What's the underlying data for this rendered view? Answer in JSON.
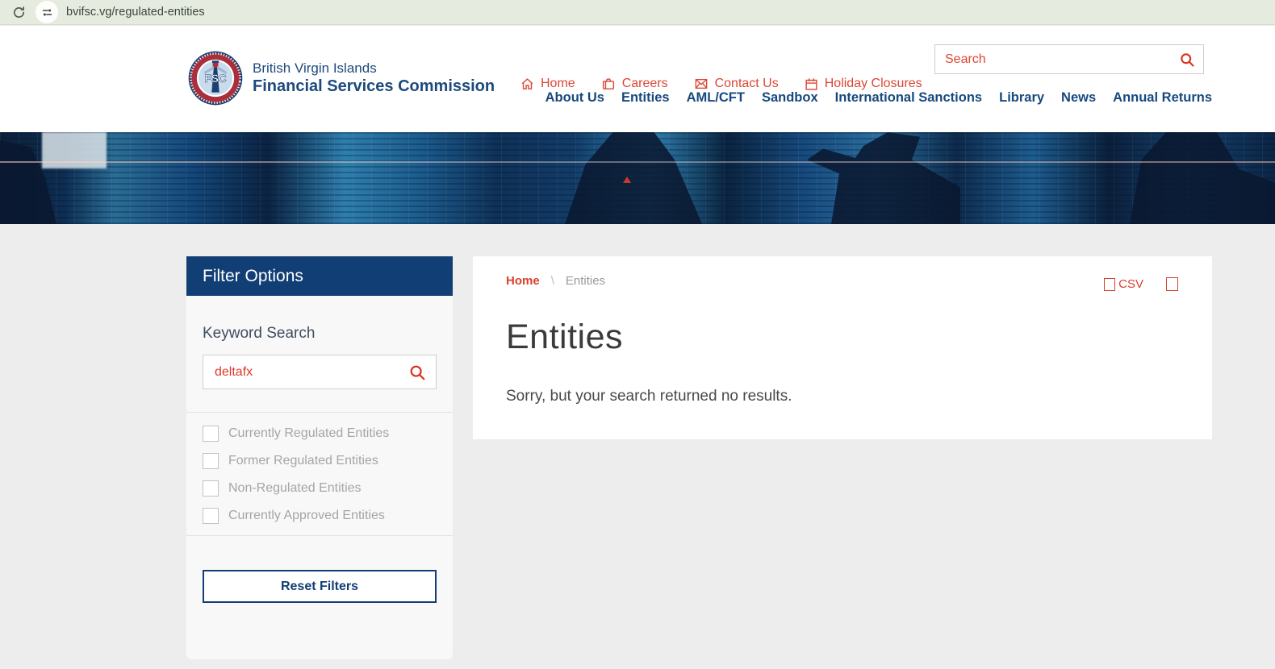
{
  "browser": {
    "url": "bvifsc.vg/regulated-entities"
  },
  "header": {
    "logo": {
      "line1": "British Virgin Islands",
      "line2": "Financial Services Commission",
      "seal_center_text": "FSC"
    },
    "utility_nav": [
      {
        "label": "Home",
        "icon": "home-icon"
      },
      {
        "label": "Careers",
        "icon": "briefcase-icon"
      },
      {
        "label": "Contact Us",
        "icon": "envelope-icon"
      },
      {
        "label": "Holiday Closures",
        "icon": "calendar-icon"
      }
    ],
    "search": {
      "placeholder": "Search"
    },
    "main_nav": [
      {
        "label": "About Us"
      },
      {
        "label": "Entities"
      },
      {
        "label": "AML/CFT"
      },
      {
        "label": "Sandbox"
      },
      {
        "label": "International Sanctions"
      },
      {
        "label": "Library"
      },
      {
        "label": "News"
      },
      {
        "label": "Annual Returns"
      }
    ]
  },
  "sidebar": {
    "title": "Filter Options",
    "keyword_label": "Keyword Search",
    "keyword_value": "deltafx",
    "checkboxes": [
      {
        "label": "Currently Regulated Entities",
        "checked": false
      },
      {
        "label": "Former Regulated Entities",
        "checked": false
      },
      {
        "label": "Non-Regulated Entities",
        "checked": false
      },
      {
        "label": "Currently Approved Entities",
        "checked": false
      }
    ],
    "reset_button": "Reset Filters"
  },
  "content": {
    "breadcrumb": {
      "home": "Home",
      "separator": "\\",
      "current": "Entities"
    },
    "export": {
      "csv_label": "CSV"
    },
    "title": "Entities",
    "no_results_message": "Sorry, but your search returned no results."
  },
  "colors": {
    "accent_red": "#dc4634",
    "navy": "#17497e",
    "dark_navy": "#113e74",
    "chrome_bg": "#e5ecdf",
    "page_bg": "#ededed",
    "panel_bg": "#f8f8f8"
  }
}
